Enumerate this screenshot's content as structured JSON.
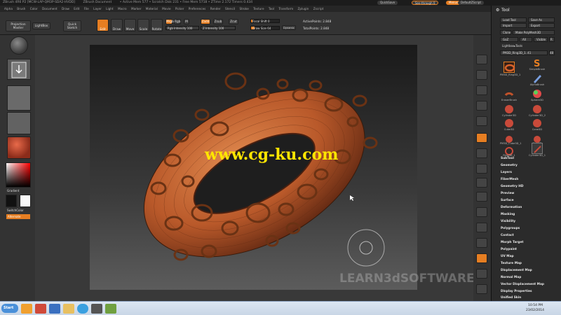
{
  "titlebar": {
    "app": "ZBrush 4R6 P2 [MCW-LAP-QM3P-SDA2-HVDD]",
    "doc": "ZBrush Document",
    "stats": "• Active Mem 577 • Scratch Disk 231 • Free Mem 5718 • ZTime 2.172 Timers 0.434",
    "quicksave": "QuickSave",
    "seethrough": "See-through 0",
    "menus": "Menus",
    "script": "DefaultZScript"
  },
  "menubar": [
    "Alpha",
    "Brush",
    "Color",
    "Document",
    "Draw",
    "Edit",
    "File",
    "Layer",
    "Light",
    "Macro",
    "Marker",
    "Material",
    "Movie",
    "Picker",
    "Preferences",
    "Render",
    "Stencil",
    "Stroke",
    "Texture",
    "Tool",
    "Transform",
    "Zplugin",
    "Zscript"
  ],
  "toolbar": {
    "projection_master": "Projection Master",
    "lightbox": "LightBox",
    "quick_sketch": "Quick Sketch",
    "edit": "Edit",
    "draw": "Draw",
    "move": "Move",
    "scale": "Scale",
    "rotate": "Rotate",
    "mrgb": "Mrgb",
    "rgb": "Rgb",
    "m": "M",
    "rgb_intensity": "Rgb Intensity 100",
    "zadd": "Zadd",
    "zsub": "Zsub",
    "zcut": "Zcut",
    "z_intensity": "Z Intensity 100",
    "focal_shift": "Focal Shift 0",
    "draw_size": "Draw Size 64",
    "dynamic": "Dynamic",
    "active_points": "ActivePoints: 2.848",
    "total_points": "TotalPoints: 2.848"
  },
  "leftshelf": {
    "gradient": "Gradient",
    "switchcolor": "SwitchColor",
    "alternate": "Alternate"
  },
  "tool_palette": {
    "title": "Tool",
    "load_tool": "Load Tool",
    "save_as": "Save As",
    "import": "Import",
    "export": "Export",
    "clone": "Clone",
    "make_polymesh": "Make PolyMesh3D",
    "goz": "GoZ",
    "all": "All",
    "visible": "Visible",
    "r": "R",
    "lightbox_tools": "Lightbox▸Tools",
    "current_tool": "PM3D_Ring3D_1. 41",
    "count": "48",
    "brushes": [
      "PM3D_Ring3D_1",
      "SimpleBrush",
      "AlphaBrush",
      "EraserBrush",
      "Sphere3D",
      "Cylinder3D",
      "Cylinder3D_2",
      "Cube3D",
      "Cone3D",
      "Sphere3D_1",
      "PM3D_Cube3D_1",
      "Ring3D",
      "Ring3D_1",
      "Cylinder3D_1"
    ],
    "subpalettes": [
      "SubTool",
      "Geometry",
      "Layers",
      "FiberMesh",
      "Geometry HD",
      "Preview",
      "Surface",
      "Deformation",
      "Masking",
      "Visibility",
      "Polygroups",
      "Contact",
      "Morph Target",
      "Polypaint",
      "UV Map",
      "Texture Map",
      "Displacement Map",
      "Normal Map",
      "Vector Displacement Map",
      "Display Properties",
      "Unified Skin"
    ]
  },
  "right_strip": [
    "BPR",
    "SPix 3",
    "Scroll",
    "Zoom",
    "Actual",
    "AAHalf",
    "Dynamic Persp",
    "Floor",
    "Local",
    "L.Sym",
    "Frame",
    "Move",
    "Scale",
    "Rotate",
    "Line Fill PolyF",
    "Transp",
    "Ghost",
    "Solo",
    "Xpose"
  ],
  "watermark": "www.cg-ku.com",
  "brandmark": "LEARN3dSOFTWARE.com",
  "taskbar": {
    "start": "Start",
    "time": "10:54 PM",
    "date": "23/02/2014"
  },
  "colors": {
    "accent": "#e67e22",
    "torus": "#c7632b"
  }
}
